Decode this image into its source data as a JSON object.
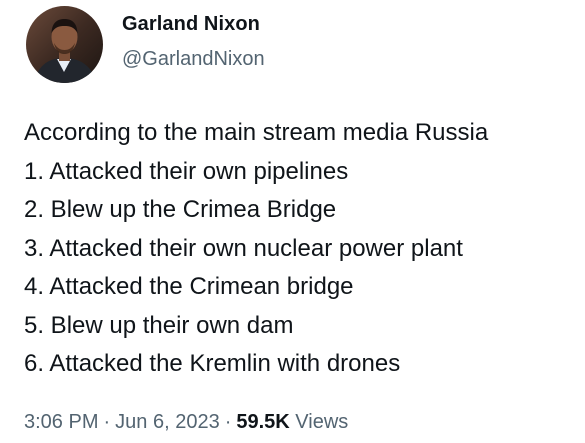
{
  "author": {
    "name": "Garland Nixon",
    "handle": "@GarlandNixon"
  },
  "tweet": {
    "lines": [
      "According to the main stream media Russia",
      "1. Attacked their own pipelines",
      "2. Blew up the Crimea Bridge",
      "3. Attacked their own nuclear power plant",
      "4. Attacked the Crimean bridge",
      "5. Blew up their own dam",
      "6. Attacked the Kremlin with drones"
    ]
  },
  "meta": {
    "time": "3:06 PM",
    "separator": "·",
    "date": "Jun 6, 2023",
    "views_count": "59.5K",
    "views_label": "Views"
  },
  "colors": {
    "text_primary": "#0f1419",
    "text_secondary": "#536471",
    "background": "#ffffff"
  }
}
